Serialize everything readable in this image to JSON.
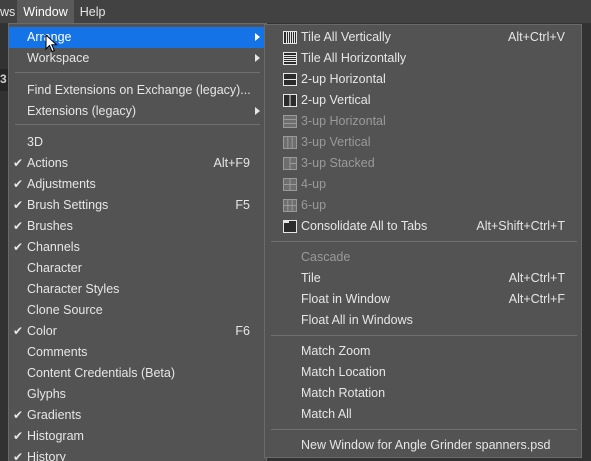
{
  "menubar": {
    "items": [
      {
        "label": "ws"
      },
      {
        "label": "Window"
      },
      {
        "label": "Help"
      }
    ]
  },
  "background": {
    "panel_letter": "3"
  },
  "window_menu": {
    "items": [
      {
        "label": "Arrange",
        "checked": false,
        "shortcut": "",
        "submenu": true,
        "highlighted": true
      },
      {
        "label": "Workspace",
        "checked": false,
        "shortcut": "",
        "submenu": true
      },
      {
        "label": "Find Extensions on Exchange (legacy)...",
        "checked": false,
        "shortcut": "",
        "submenu": false
      },
      {
        "label": "Extensions (legacy)",
        "checked": false,
        "shortcut": "",
        "submenu": true
      },
      {
        "label": "3D",
        "checked": false,
        "shortcut": "",
        "submenu": false
      },
      {
        "label": "Actions",
        "checked": true,
        "shortcut": "Alt+F9",
        "submenu": false
      },
      {
        "label": "Adjustments",
        "checked": true,
        "shortcut": "",
        "submenu": false
      },
      {
        "label": "Brush Settings",
        "checked": true,
        "shortcut": "F5",
        "submenu": false
      },
      {
        "label": "Brushes",
        "checked": true,
        "shortcut": "",
        "submenu": false
      },
      {
        "label": "Channels",
        "checked": true,
        "shortcut": "",
        "submenu": false
      },
      {
        "label": "Character",
        "checked": false,
        "shortcut": "",
        "submenu": false
      },
      {
        "label": "Character Styles",
        "checked": false,
        "shortcut": "",
        "submenu": false
      },
      {
        "label": "Clone Source",
        "checked": false,
        "shortcut": "",
        "submenu": false
      },
      {
        "label": "Color",
        "checked": true,
        "shortcut": "F6",
        "submenu": false
      },
      {
        "label": "Comments",
        "checked": false,
        "shortcut": "",
        "submenu": false
      },
      {
        "label": "Content Credentials (Beta)",
        "checked": false,
        "shortcut": "",
        "submenu": false
      },
      {
        "label": "Glyphs",
        "checked": false,
        "shortcut": "",
        "submenu": false
      },
      {
        "label": "Gradients",
        "checked": true,
        "shortcut": "",
        "submenu": false
      },
      {
        "label": "Histogram",
        "checked": true,
        "shortcut": "",
        "submenu": false
      },
      {
        "label": "History",
        "checked": true,
        "shortcut": "",
        "submenu": false
      }
    ],
    "check_glyph": "✔"
  },
  "arrange_submenu": {
    "items": [
      {
        "label": "Tile All Vertically",
        "shortcut": "Alt+Ctrl+V",
        "icon": "tile-vertical-icon",
        "disabled": false
      },
      {
        "label": "Tile All Horizontally",
        "shortcut": "",
        "icon": "tile-horizontal-icon",
        "disabled": false
      },
      {
        "label": "2-up Horizontal",
        "shortcut": "",
        "icon": "2up-horizontal-icon",
        "disabled": false
      },
      {
        "label": "2-up Vertical",
        "shortcut": "",
        "icon": "2up-vertical-icon",
        "disabled": false
      },
      {
        "label": "3-up Horizontal",
        "shortcut": "",
        "icon": "3up-horizontal-icon",
        "disabled": true
      },
      {
        "label": "3-up Vertical",
        "shortcut": "",
        "icon": "3up-vertical-icon",
        "disabled": true
      },
      {
        "label": "3-up Stacked",
        "shortcut": "",
        "icon": "3up-stacked-icon",
        "disabled": true
      },
      {
        "label": "4-up",
        "shortcut": "",
        "icon": "4up-icon",
        "disabled": true
      },
      {
        "label": "6-up",
        "shortcut": "",
        "icon": "6up-icon",
        "disabled": true
      },
      {
        "label": "Consolidate All to Tabs",
        "shortcut": "Alt+Shift+Ctrl+T",
        "icon": "consolidate-tabs-icon",
        "disabled": false
      },
      {
        "label": "Cascade",
        "shortcut": "",
        "icon": "",
        "disabled": true
      },
      {
        "label": "Tile",
        "shortcut": "Alt+Ctrl+T",
        "icon": "",
        "disabled": false
      },
      {
        "label": "Float in Window",
        "shortcut": "Alt+Ctrl+F",
        "icon": "",
        "disabled": false
      },
      {
        "label": "Float All in Windows",
        "shortcut": "",
        "icon": "",
        "disabled": false
      },
      {
        "label": "Match Zoom",
        "shortcut": "",
        "icon": "",
        "disabled": false
      },
      {
        "label": "Match Location",
        "shortcut": "",
        "icon": "",
        "disabled": false
      },
      {
        "label": "Match Rotation",
        "shortcut": "",
        "icon": "",
        "disabled": false
      },
      {
        "label": "Match All",
        "shortcut": "",
        "icon": "",
        "disabled": false
      },
      {
        "label": "New Window for Angle Grinder spanners.psd",
        "shortcut": "",
        "icon": "",
        "disabled": false
      }
    ]
  },
  "colors": {
    "menu_bg": "#535353",
    "menubar_bg": "#424242",
    "highlight": "#1473e6",
    "text": "#e6e6e6",
    "disabled_text": "#9a9a9a"
  }
}
